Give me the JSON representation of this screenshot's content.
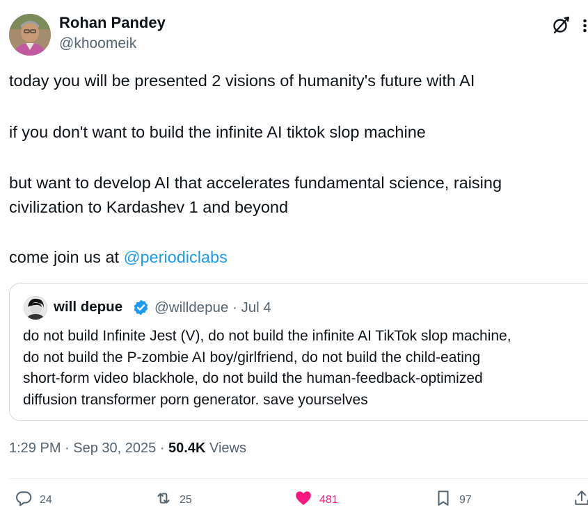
{
  "author": {
    "name": "Rohan Pandey",
    "handle": "@khoomeik"
  },
  "icons": {
    "grok": "grok-icon",
    "more": "more-icon",
    "verified": "verified-badge-icon",
    "reply": "reply-icon",
    "repost": "repost-icon",
    "like": "heart-icon",
    "bookmark": "bookmark-icon",
    "share": "share-icon"
  },
  "tweet": {
    "line1": "today you will be presented 2 visions of humanity's future with AI",
    "line2": "if you don't want to build the infinite AI tiktok slop machine",
    "line3a": "but want to develop AI that accelerates fundamental science, raising",
    "line3b": "civilization to Kardashev 1 and beyond",
    "line4_prefix": "come join us at ",
    "mention": "@periodiclabs"
  },
  "quote": {
    "name": "will depue",
    "handle": "@willdepue",
    "separator": " · ",
    "date": "Jul 4",
    "lines": [
      "do not build Infinite Jest (V), do not build the infinite AI TikTok slop machine,",
      "do not build the P-zombie AI boy/girlfriend, do not build the child-eating",
      "short-form video blackhole, do not build the human-feedback-optimized",
      "diffusion transformer porn generator. save yourselves"
    ]
  },
  "meta": {
    "time": "1:29 PM",
    "dot": " · ",
    "date": "Sep 30, 2025",
    "views_count": "50.4K",
    "views_label": " Views"
  },
  "actions": {
    "replies": "24",
    "reposts": "25",
    "likes": "481",
    "bookmarks": "97"
  },
  "colors": {
    "text": "#0f1419",
    "secondary": "#536471",
    "link": "#1d9bf0",
    "like": "#f91880",
    "border": "#cfd9de"
  }
}
